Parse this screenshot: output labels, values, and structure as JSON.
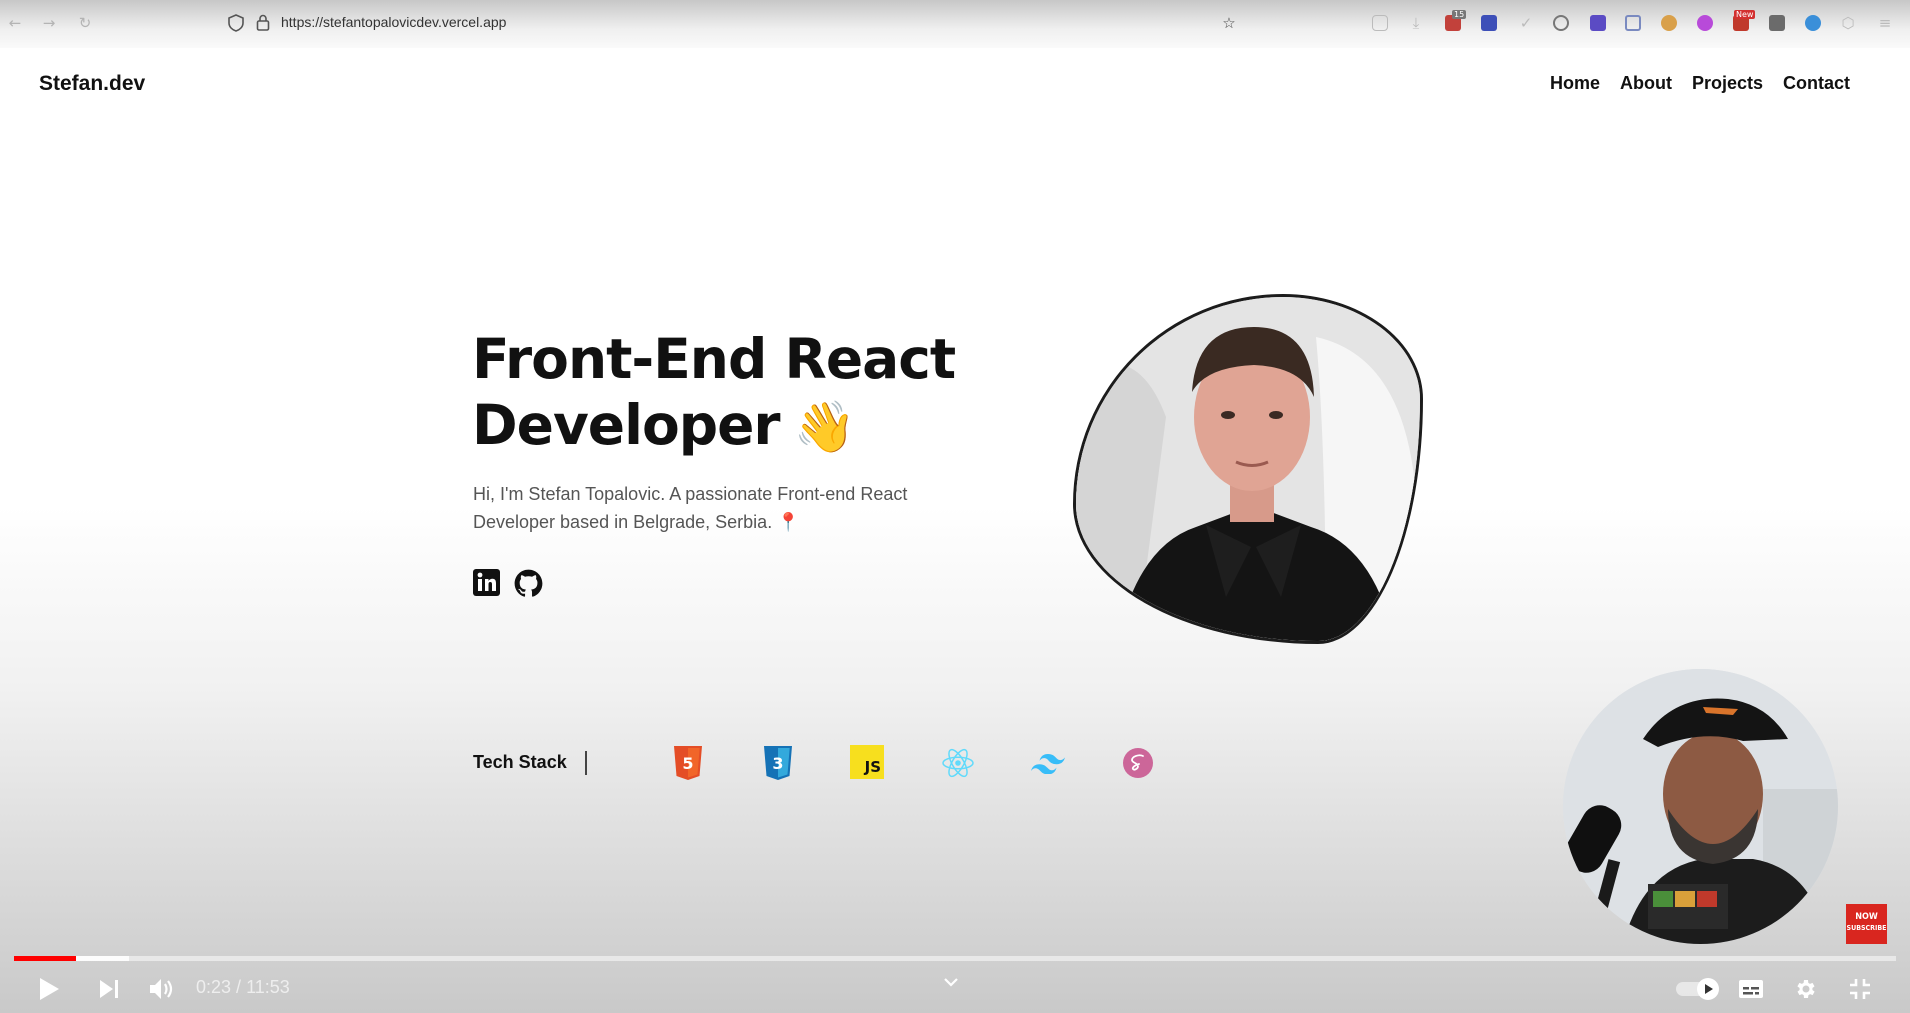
{
  "browser": {
    "url": "https://stefantopalovicdev.vercel.app",
    "ext_badges": [
      "15",
      "New"
    ]
  },
  "site": {
    "logo": "Stefan.dev",
    "nav": [
      "Home",
      "About",
      "Projects",
      "Contact"
    ]
  },
  "hero": {
    "title_line1": "Front-End React",
    "title_line2": "Developer",
    "wave_emoji": "👋",
    "description_line1": "Hi, I'm Stefan Topalovic. A passionate Front-end React",
    "description_line2": "Developer based in Belgrade, Serbia. 📍",
    "socials": [
      "linkedin-icon",
      "github-icon"
    ]
  },
  "tech_stack": {
    "label": "Tech Stack",
    "icons": [
      "html5-icon",
      "css3-icon",
      "javascript-icon",
      "react-icon",
      "tailwind-icon",
      "sass-icon"
    ],
    "js_text": "JS"
  },
  "overlay": {
    "subscribe_line1": "NOW",
    "subscribe_line2": "SUBSCRIBE"
  },
  "player": {
    "progress_fraction": 0.033,
    "buffered_fraction": 0.061,
    "current_time": "0:23",
    "separator": " / ",
    "duration": "11:53"
  },
  "colors": {
    "progress": "#ff0000",
    "html5": "#e44d26",
    "css3": "#1572b6",
    "js": "#f7df1e",
    "react": "#61dafb",
    "tailwind": "#38bdf8",
    "sass": "#cc6699"
  }
}
